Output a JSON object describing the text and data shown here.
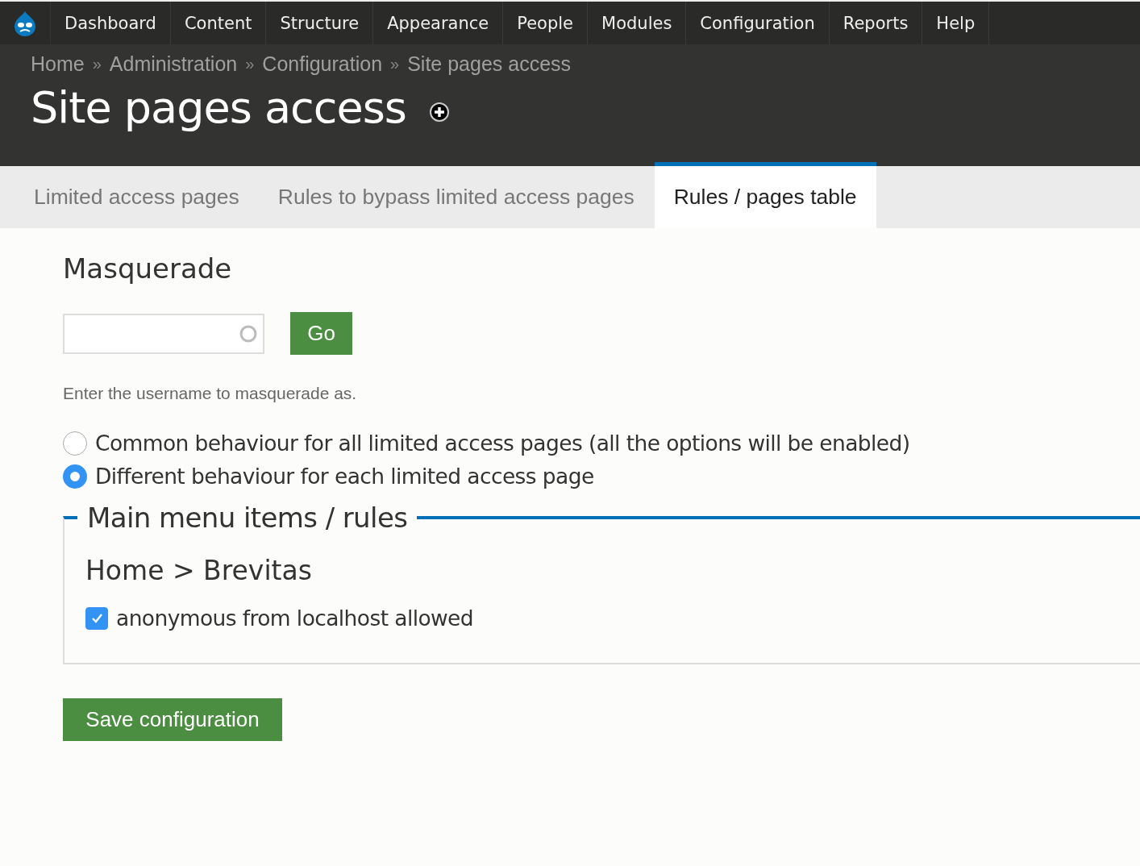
{
  "toolbar": {
    "items": [
      {
        "label": "Dashboard"
      },
      {
        "label": "Content"
      },
      {
        "label": "Structure"
      },
      {
        "label": "Appearance"
      },
      {
        "label": "People"
      },
      {
        "label": "Modules"
      },
      {
        "label": "Configuration"
      },
      {
        "label": "Reports"
      },
      {
        "label": "Help"
      }
    ]
  },
  "breadcrumb": {
    "separator": "»",
    "items": [
      "Home",
      "Administration",
      "Configuration",
      "Site pages access"
    ]
  },
  "page_title": "Site pages access",
  "tabs": [
    {
      "label": "Limited access pages",
      "selected": false
    },
    {
      "label": "Rules to bypass limited access pages",
      "selected": false
    },
    {
      "label": "Rules / pages table",
      "selected": true
    }
  ],
  "masquerade": {
    "title": "Masquerade",
    "button": "Go",
    "description": "Enter the username to masquerade as."
  },
  "behaviour_options": [
    {
      "label": "Common behaviour for all limited access pages (all the options will be enabled)",
      "selected": false
    },
    {
      "label": "Different behaviour for each limited access page",
      "selected": true
    }
  ],
  "fieldset": {
    "legend": "Main menu items / rules",
    "sections": [
      {
        "title": "Home > Brevitas",
        "rules": [
          {
            "label": "anonymous from localhost allowed",
            "checked": true
          }
        ]
      }
    ]
  },
  "save_button": "Save configuration"
}
